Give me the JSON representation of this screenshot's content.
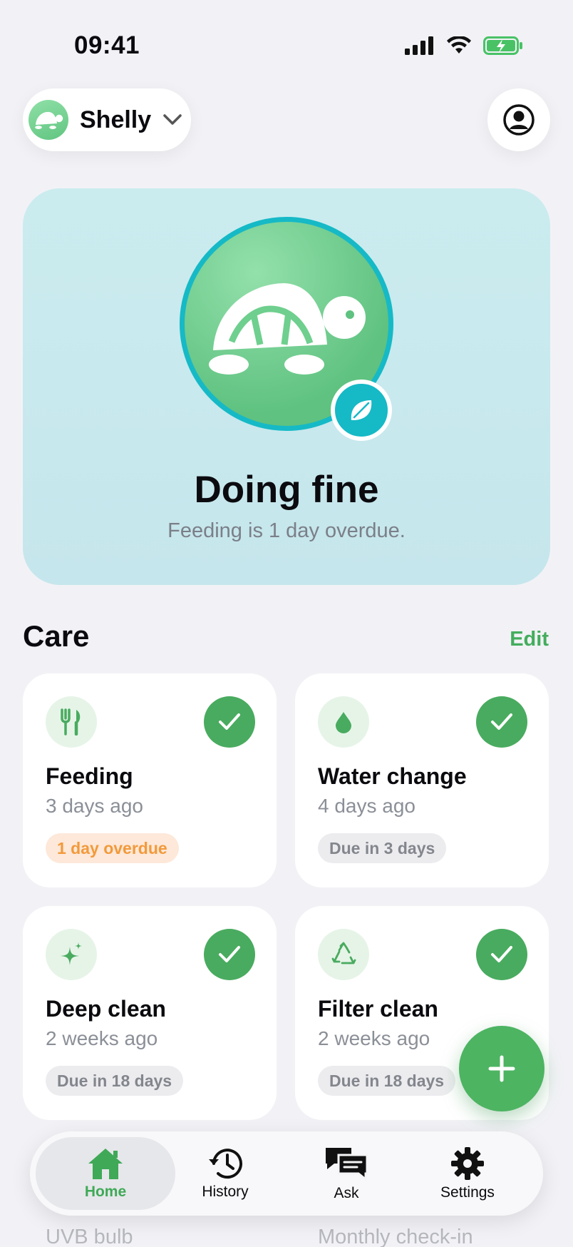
{
  "status_bar": {
    "time": "09:41"
  },
  "header": {
    "pet_name": "Shelly"
  },
  "hero": {
    "title": "Doing fine",
    "subtitle": "Feeding is 1 day overdue."
  },
  "care": {
    "section_title": "Care",
    "edit_label": "Edit",
    "cards": [
      {
        "title": "Feeding",
        "subtitle": "3 days ago",
        "badge": "1 day overdue",
        "status": "overdue",
        "icon": "fork-knife-icon"
      },
      {
        "title": "Water change",
        "subtitle": "4 days ago",
        "badge": "Due in 3 days",
        "status": "due",
        "icon": "water-drop-icon"
      },
      {
        "title": "Deep clean",
        "subtitle": "2 weeks ago",
        "badge": "Due in 18 days",
        "status": "due",
        "icon": "sparkles-icon"
      },
      {
        "title": "Filter clean",
        "subtitle": "2 weeks ago",
        "badge": "Due in 18 days",
        "status": "due",
        "icon": "recycle-icon"
      }
    ],
    "partial_cards": [
      "UVB bulb",
      "Monthly check-in"
    ]
  },
  "tabs": [
    {
      "label": "Home",
      "icon": "house-icon",
      "active": true
    },
    {
      "label": "History",
      "icon": "clock-history-icon",
      "active": false
    },
    {
      "label": "Ask",
      "icon": "chat-bubbles-icon",
      "active": false
    },
    {
      "label": "Settings",
      "icon": "gear-icon",
      "active": false
    }
  ],
  "colors": {
    "accent": "#49ab5f",
    "teal": "#16b9c6",
    "overdue": "#f29a3b",
    "background": "#f2f2f6"
  }
}
